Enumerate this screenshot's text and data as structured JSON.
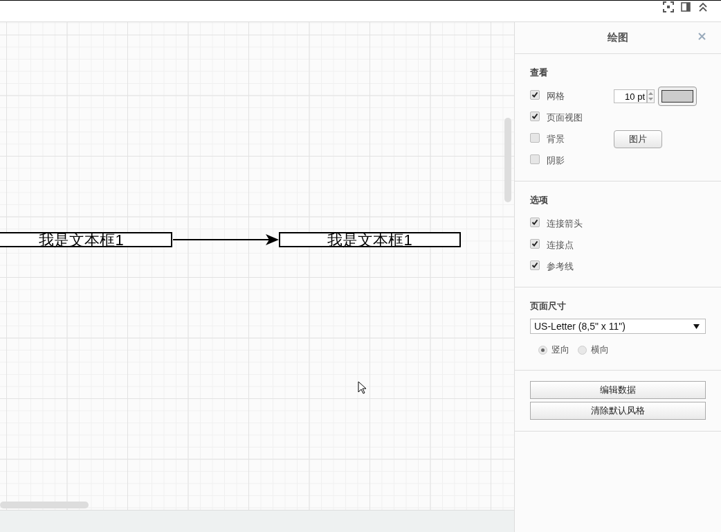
{
  "canvas": {
    "shapes": [
      {
        "label": "我是文本框1"
      },
      {
        "label": "我是文本框1"
      }
    ]
  },
  "panel": {
    "title": "绘图",
    "sections": [
      {
        "heading": "查看",
        "options": [
          {
            "kind": "grid",
            "label": "网格",
            "checked": true,
            "value": "10 pt"
          },
          {
            "kind": "plain",
            "label": "页面视图",
            "checked": true
          },
          {
            "kind": "image",
            "label": "背景",
            "checked": false,
            "button": "图片"
          },
          {
            "kind": "plain",
            "label": "阴影",
            "checked": false
          }
        ]
      },
      {
        "heading": "选项",
        "options": [
          {
            "kind": "plain",
            "label": "连接箭头",
            "checked": true
          },
          {
            "kind": "plain",
            "label": "连接点",
            "checked": true
          },
          {
            "kind": "plain",
            "label": "参考线",
            "checked": true
          }
        ]
      }
    ],
    "page_size": {
      "heading": "页面尺寸",
      "value": "US-Letter (8,5\" x 11\")",
      "orientation": [
        {
          "label": "竖向",
          "selected": true
        },
        {
          "label": "横向",
          "selected": false
        }
      ]
    },
    "buttons": [
      "编辑数据",
      "清除默认风格"
    ]
  }
}
